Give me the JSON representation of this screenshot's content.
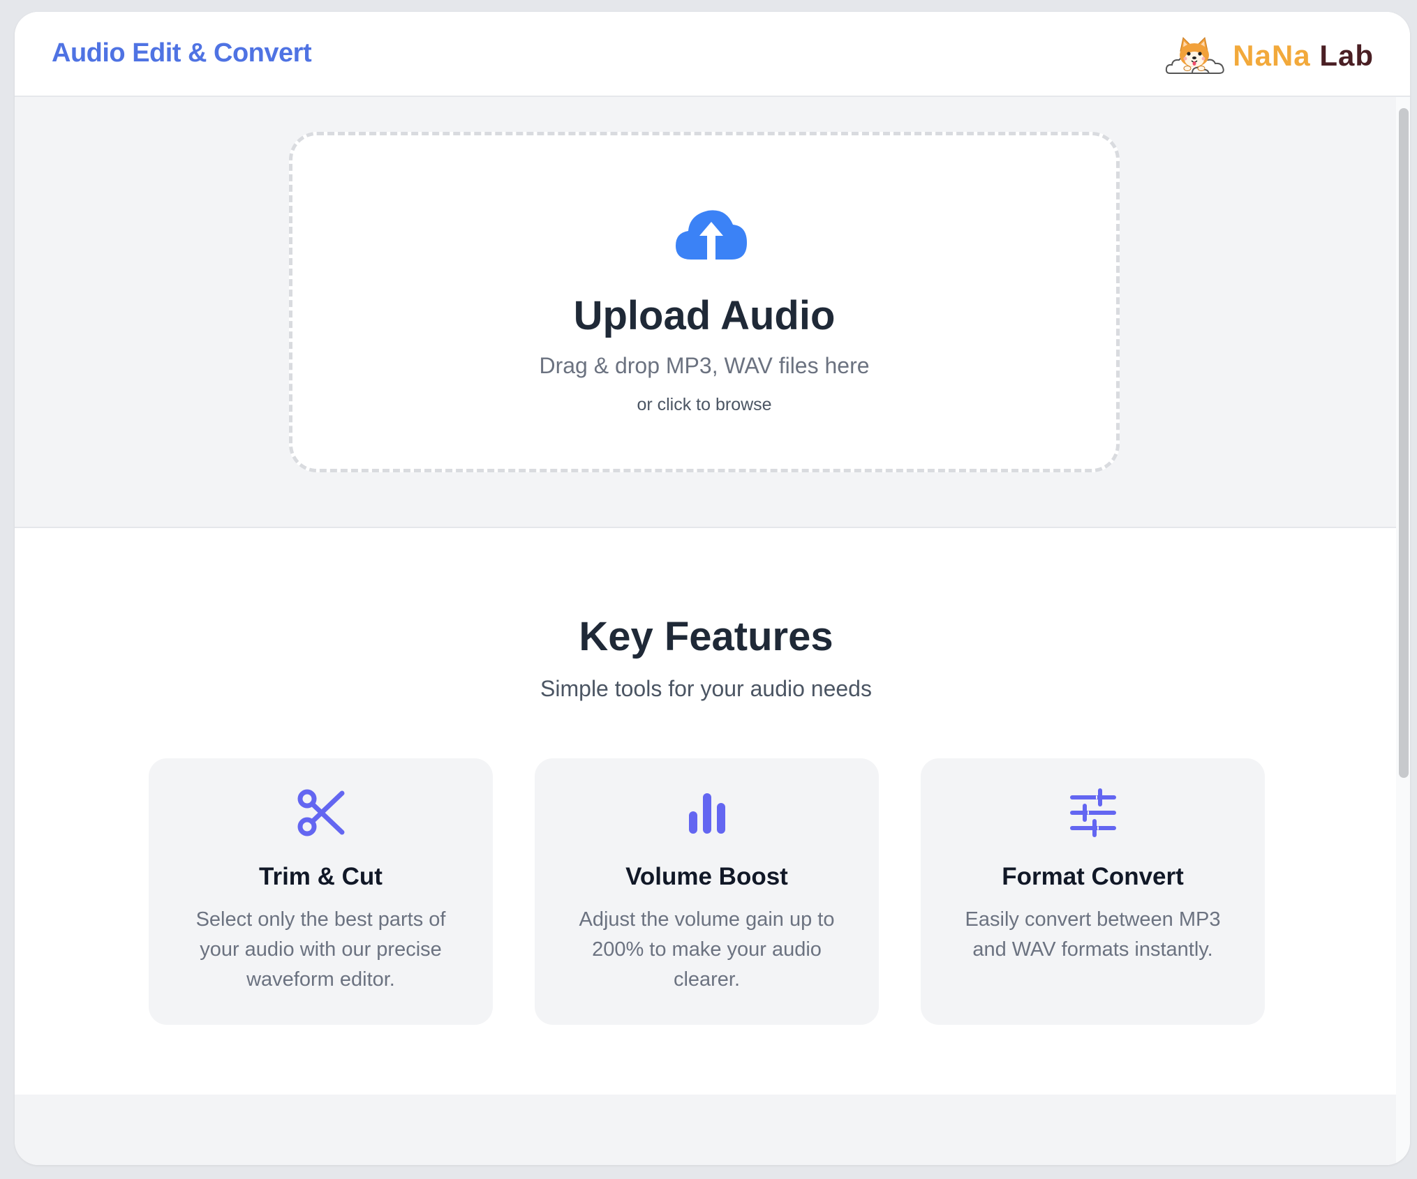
{
  "header": {
    "app_title": "Audio Edit & Convert",
    "brand": {
      "part1": "Na",
      "part2": "Na",
      "part3": " Lab",
      "logo_icon": "shiba-dog-cloud-icon"
    }
  },
  "upload": {
    "icon": "cloud-upload-icon",
    "title": "Upload Audio",
    "subtitle": "Drag & drop MP3, WAV files here",
    "hint": "or click to browse"
  },
  "features": {
    "title": "Key Features",
    "subtitle": "Simple tools for your audio needs",
    "cards": [
      {
        "icon": "scissors-icon",
        "title": "Trim & Cut",
        "description": "Select only the best parts of your audio with our precise waveform editor."
      },
      {
        "icon": "bar-chart-icon",
        "title": "Volume Boost",
        "description": "Adjust the volume gain up to 200% to make your audio clearer."
      },
      {
        "icon": "sliders-icon",
        "title": "Format Convert",
        "description": "Easily convert between MP3 and WAV formats instantly."
      }
    ]
  },
  "colors": {
    "accent_blue": "#4f73e3",
    "upload_icon": "#3b82f6",
    "feature_icon": "#6366f1",
    "heading": "#1f2937",
    "muted_text": "#6b7280",
    "section_bg": "#f3f4f6"
  }
}
